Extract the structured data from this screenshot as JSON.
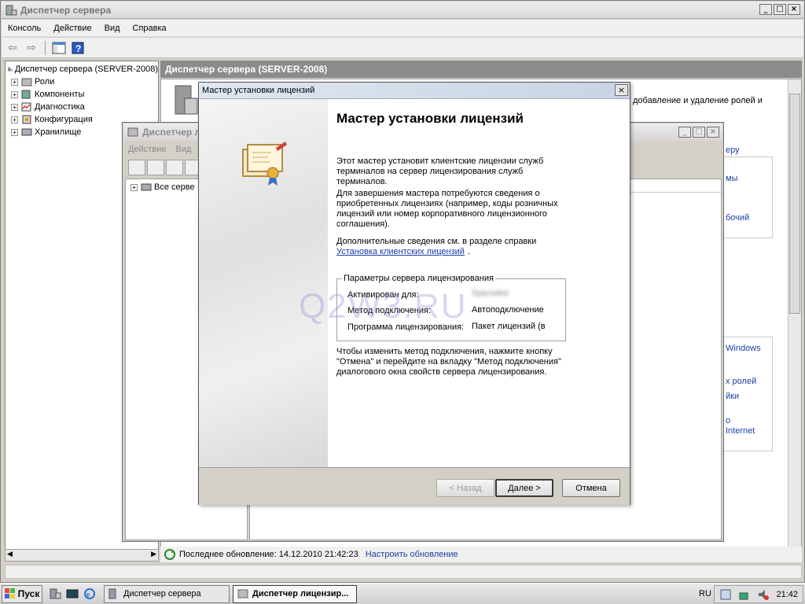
{
  "main_window": {
    "title": "Диспетчер сервера",
    "menu": [
      "Консоль",
      "Действие",
      "Вид",
      "Справка"
    ],
    "tree": {
      "root": "Диспетчер сервера (SERVER-2008)",
      "items": [
        "Роли",
        "Компоненты",
        "Диагностика",
        "Конфигурация",
        "Хранилище"
      ]
    },
    "header": "Диспетчер сервера (SERVER-2008)",
    "right_fragments": {
      "top_text": "добавление и удаление ролей и",
      "link1": "еру",
      "frag1": "мы",
      "frag2": "бочий",
      "frag3": "Windows",
      "frag4": "х ролей",
      "frag5": "йки",
      "frag6": "о",
      "frag7": "Internet"
    },
    "status": {
      "last_update": "Последнее обновление: 14.12.2010 21:42:23",
      "configure_link": "Настроить обновление"
    }
  },
  "license_manager": {
    "title": "Диспетчер л",
    "menu": [
      "Действие",
      "Вид"
    ],
    "tree_item": "Все серве"
  },
  "wizard": {
    "title": "Мастер установки лицензий",
    "heading": "Мастер установки лицензий",
    "para1": "Этот мастер установит клиентские лицензии служб терминалов на сервер лицензирования служб терминалов.",
    "para2": "Для завершения мастера потребуются сведения о приобретенных лицензиях (например, коды розничных лицензий или номер корпоративного лицензионного соглашения).",
    "para3": "Дополнительные сведения см. в разделе справки",
    "help_link": "Установка клиентских лицензий",
    "group_title": "Параметры сервера лицензирования",
    "activated_label": "Активирован для:",
    "activated_value": "Specialist",
    "method_label": "Метод подключения:",
    "method_value": "Автоподключение",
    "program_label": "Программа лицензирования:",
    "program_value": "Пакет лицензий (в",
    "para4": "Чтобы изменить метод подключения, нажмите кнопку \"Отмена\" и перейдите на вкладку \"Метод подключения\" диалогового окна свойств сервера лицензирования.",
    "back_button": "< Назад",
    "next_button": "Далее >",
    "cancel_button": "Отмена"
  },
  "watermark": "Q2W3.RU",
  "taskbar": {
    "start": "Пуск",
    "tasks": [
      "Диспетчер сервера",
      "Диспетчер лицензир..."
    ],
    "lang": "RU",
    "clock": "21:42"
  }
}
